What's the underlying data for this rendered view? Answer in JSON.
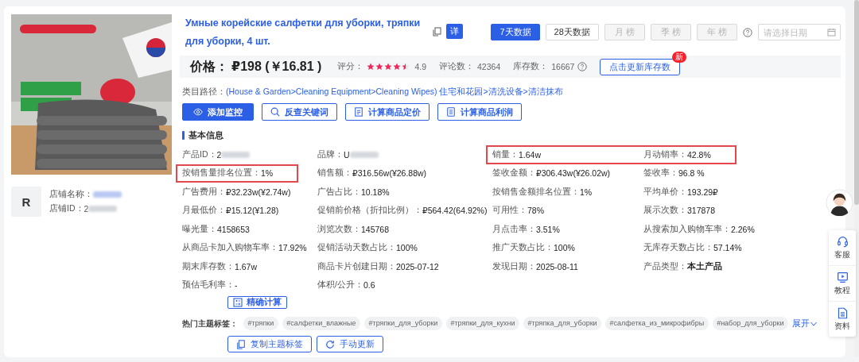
{
  "product": {
    "title": "Умные корейские салфетки для уборки, тряпки для уборки, 4 шт.",
    "detail_badge": "详"
  },
  "period_tabs": [
    {
      "label": "7天数据",
      "selected": true,
      "disabled": false
    },
    {
      "label": "28天数据",
      "selected": false,
      "disabled": false
    },
    {
      "label": "月 榜",
      "selected": false,
      "disabled": true
    },
    {
      "label": "季 榜",
      "selected": false,
      "disabled": true
    },
    {
      "label": "年 榜",
      "selected": false,
      "disabled": true
    }
  ],
  "date_field": {
    "placeholder": "请选择日期"
  },
  "price_bar": {
    "price_label": "价格：",
    "price": "₽198 (￥16.81 )",
    "rating_label": "评分：",
    "stars": 4.5,
    "rating": "4.9",
    "reviews_label": "评论数：",
    "reviews": "42364",
    "stock_label": "库存数：",
    "stock": "16667",
    "update_button": "点击更新库存数",
    "new_badge": "新"
  },
  "category": {
    "label": "类目路径：",
    "path": "(House & Garden>Cleaning Equipment>Cleaning Wipes) 住宅和花园>清洗设备>清洁抹布"
  },
  "actions": [
    {
      "label": "添加监控",
      "kind": "primary"
    },
    {
      "label": "反查关键词",
      "kind": "outline"
    },
    {
      "label": "计算商品定价",
      "kind": "outline"
    },
    {
      "label": "计算商品利润",
      "kind": "outline"
    }
  ],
  "section_title": "基本信息",
  "metrics": [
    [
      {
        "label": "产品ID：",
        "value": "2",
        "redacted": true,
        "highlighted": false
      },
      {
        "label": "品牌：",
        "value": "U",
        "redacted": true,
        "highlighted": false
      },
      {
        "label": "销量：",
        "value": "1.64w",
        "redacted": false,
        "highlighted": true
      },
      {
        "label": "月动销率：",
        "value": "42.8%",
        "redacted": false,
        "highlighted": true
      }
    ],
    [
      {
        "label": "按销售量排名位置：",
        "value": "1%",
        "redacted": false,
        "highlighted": true
      },
      {
        "label": "销售额：",
        "value": "₽316.56w(¥26.88w)",
        "redacted": false,
        "highlighted": false
      },
      {
        "label": "签收金额：",
        "value": "₽306.43w(¥26.02w)",
        "redacted": false,
        "highlighted": false
      },
      {
        "label": "签收率：",
        "value": "96.8 %",
        "redacted": false,
        "highlighted": false
      }
    ],
    [
      {
        "label": "广告费用：",
        "value": "₽32.23w(¥2.74w)",
        "redacted": false,
        "highlighted": false
      },
      {
        "label": "广告占比：",
        "value": "10.18%",
        "redacted": false,
        "highlighted": false
      },
      {
        "label": "按销售金额排名位置：",
        "value": "1%",
        "redacted": false,
        "highlighted": false
      },
      {
        "label": "平均单价：",
        "value": "193.29₽",
        "redacted": false,
        "highlighted": false
      }
    ],
    [
      {
        "label": "月最低价：",
        "value": "₽15.12(¥1.28)",
        "redacted": false,
        "highlighted": false
      },
      {
        "label": "促销前价格（折扣比例）：",
        "value": "₽564.42(64.92%)",
        "redacted": false,
        "highlighted": false
      },
      {
        "label": "可用性：",
        "value": "78%",
        "redacted": false,
        "highlighted": false
      },
      {
        "label": "展示次数：",
        "value": "317878",
        "redacted": false,
        "highlighted": false
      }
    ],
    [
      {
        "label": "曝光量：",
        "value": "4158653",
        "redacted": false,
        "highlighted": false
      },
      {
        "label": "浏览次数：",
        "value": "145768",
        "redacted": false,
        "highlighted": false
      },
      {
        "label": "月点击率：",
        "value": "3.51%",
        "redacted": false,
        "highlighted": false
      },
      {
        "label": "从搜索加入购物车率：",
        "value": "2.26%",
        "redacted": false,
        "highlighted": false
      }
    ],
    [
      {
        "label": "从商品卡加入购物车率：",
        "value": "17.92%",
        "redacted": false,
        "highlighted": false
      },
      {
        "label": "促销活动天数占比：",
        "value": "100%",
        "redacted": false,
        "highlighted": false
      },
      {
        "label": "推广天数占比：",
        "value": "100%",
        "redacted": false,
        "highlighted": false
      },
      {
        "label": "无库存天数占比：",
        "value": "57.14%",
        "redacted": false,
        "highlighted": false
      }
    ],
    [
      {
        "label": "期末库存数：",
        "value": "1.67w",
        "redacted": false,
        "highlighted": false
      },
      {
        "label": "商品卡片创建日期：",
        "value": "2025-07-12",
        "redacted": false,
        "highlighted": false
      },
      {
        "label": "发现日期：",
        "value": "2025-08-11",
        "redacted": false,
        "highlighted": false
      },
      {
        "label": "产品类型：",
        "value": "本土产品",
        "redacted": false,
        "highlighted": false
      }
    ],
    [
      {
        "label": "预估毛利率：",
        "value": "-",
        "redacted": false,
        "highlighted": false
      },
      {
        "label": "体积/公升：",
        "value": "0.6",
        "redacted": false,
        "highlighted": false
      }
    ]
  ],
  "calc_button": "精确计算",
  "tags": {
    "label": "热门主题标签：",
    "items": [
      "#тряпки",
      "#салфетки_влажные",
      "#тряпки_для_уборки",
      "#тряпки_для_кухни",
      "#тряпка_для_уборки",
      "#салфетка_из_микрофибры",
      "#набор_для_уборки"
    ],
    "expand": "展开"
  },
  "tag_actions": [
    "复制主题标签",
    "手动更新"
  ],
  "store": {
    "avatar_letter": "R",
    "name_label": "店铺名称：",
    "name_redacted": true,
    "id_label": "店铺ID：",
    "id_value": "2",
    "id_redacted": true
  },
  "side_panel": [
    "客服",
    "教程",
    "资料"
  ]
}
